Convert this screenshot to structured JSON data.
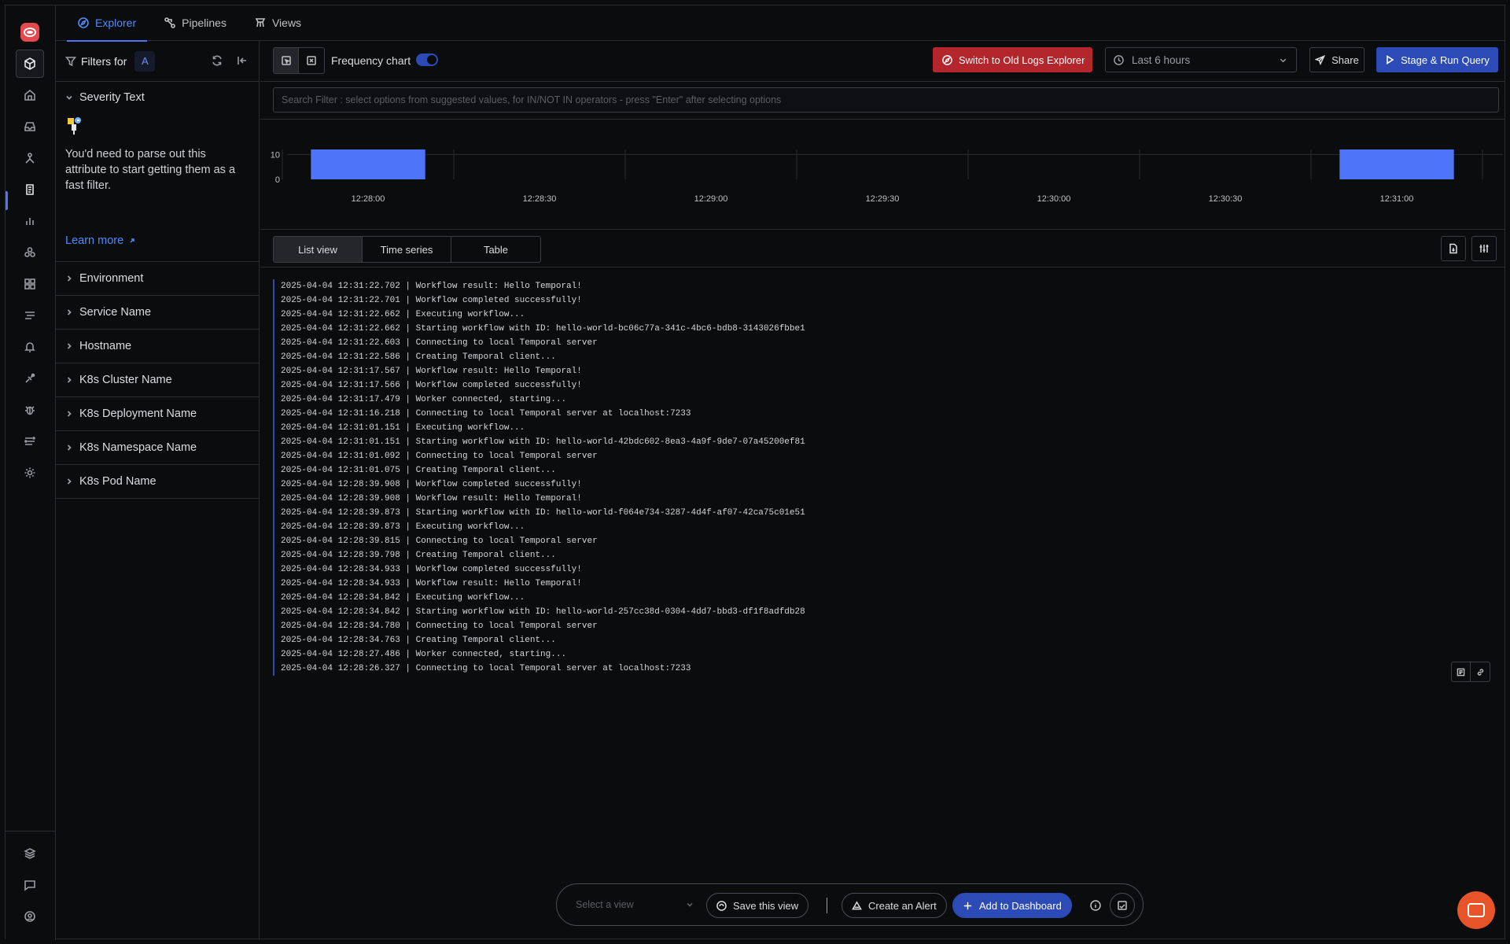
{
  "nav": {
    "tabs": [
      {
        "label": "Explorer",
        "icon": "compass-icon",
        "active": true
      },
      {
        "label": "Pipelines",
        "icon": "pipeline-icon",
        "active": false
      },
      {
        "label": "Views",
        "icon": "views-icon",
        "active": false
      }
    ]
  },
  "sidebar": {
    "icons": [
      "logs-explorer-icon",
      "home-icon",
      "inbox-icon",
      "services-icon",
      "logs-icon",
      "metrics-icon",
      "integrations-icon",
      "dashboards-icon",
      "traces-icon",
      "alerts-icon",
      "pipelines-icon",
      "exceptions-icon",
      "messaging-icon",
      "settings-icon",
      "layers-icon",
      "feedback-icon",
      "user-icon"
    ]
  },
  "filters": {
    "title": "Filters for",
    "badge": "A",
    "severity": {
      "label": "Severity Text",
      "note": "You'd need to parse out this attribute to start getting them as a fast filter.",
      "learn_more": "Learn more"
    },
    "facets": [
      "Environment",
      "Service Name",
      "Hostname",
      "K8s Cluster Name",
      "K8s Deployment Name",
      "K8s Namespace Name",
      "K8s Pod Name"
    ]
  },
  "toolbar": {
    "frequency_label": "Frequency chart",
    "frequency_on": true,
    "old_explorer": "Switch to Old Logs Explorer",
    "time_range": "Last 6 hours",
    "share": "Share",
    "run": "Stage & Run Query"
  },
  "search": {
    "placeholder": "Search Filter : select options from suggested values, for IN/NOT IN operators - press \"Enter\" after selecting options"
  },
  "chart_data": {
    "type": "bar",
    "y_ticks": [
      "10",
      "0"
    ],
    "x_ticks": [
      "12:28:00",
      "12:28:30",
      "12:29:00",
      "12:29:30",
      "12:30:00",
      "12:30:30",
      "12:31:00"
    ],
    "bars": [
      {
        "start": "12:27:50",
        "end": "12:28:10",
        "value": 12
      },
      {
        "start": "12:30:50",
        "end": "12:31:10",
        "value": 12
      }
    ],
    "ylim": [
      0,
      12
    ],
    "color": "#4e74f8"
  },
  "views": {
    "tabs": [
      "List view",
      "Time series",
      "Table"
    ],
    "active": "List view"
  },
  "logs": [
    "2025-04-04 12:31:22.702 | Workflow result: Hello Temporal!",
    "2025-04-04 12:31:22.701 | Workflow completed successfully!",
    "2025-04-04 12:31:22.662 | Executing workflow...",
    "2025-04-04 12:31:22.662 | Starting workflow with ID: hello-world-bc06c77a-341c-4bc6-bdb8-3143026fbbe1",
    "2025-04-04 12:31:22.603 | Connecting to local Temporal server",
    "2025-04-04 12:31:22.586 | Creating Temporal client...",
    "2025-04-04 12:31:17.567 | Workflow result: Hello Temporal!",
    "2025-04-04 12:31:17.566 | Workflow completed successfully!",
    "2025-04-04 12:31:17.479 | Worker connected, starting...",
    "2025-04-04 12:31:16.218 | Connecting to local Temporal server at localhost:7233",
    "2025-04-04 12:31:01.151 | Executing workflow...",
    "2025-04-04 12:31:01.151 | Starting workflow with ID: hello-world-42bdc602-8ea3-4a9f-9de7-07a45200ef81",
    "2025-04-04 12:31:01.092 | Connecting to local Temporal server",
    "2025-04-04 12:31:01.075 | Creating Temporal client...",
    "2025-04-04 12:28:39.908 | Workflow completed successfully!",
    "2025-04-04 12:28:39.908 | Workflow result: Hello Temporal!",
    "2025-04-04 12:28:39.873 | Starting workflow with ID: hello-world-f064e734-3287-4d4f-af07-42ca75c01e51",
    "2025-04-04 12:28:39.873 | Executing workflow...",
    "2025-04-04 12:28:39.815 | Connecting to local Temporal server",
    "2025-04-04 12:28:39.798 | Creating Temporal client...",
    "2025-04-04 12:28:34.933 | Workflow completed successfully!",
    "2025-04-04 12:28:34.933 | Workflow result: Hello Temporal!",
    "2025-04-04 12:28:34.842 | Executing workflow...",
    "2025-04-04 12:28:34.842 | Starting workflow with ID: hello-world-257cc38d-0304-4dd7-bbd3-df1f8adfdb28",
    "2025-04-04 12:28:34.780 | Connecting to local Temporal server",
    "2025-04-04 12:28:34.763 | Creating Temporal client...",
    "2025-04-04 12:28:27.486 | Worker connected, starting...",
    "2025-04-04 12:28:26.327 | Connecting to local Temporal server at localhost:7233"
  ],
  "bottom": {
    "select_placeholder": "Select a view",
    "save_view": "Save this view",
    "create_alert": "Create an Alert",
    "add_dashboard": "Add to Dashboard"
  }
}
